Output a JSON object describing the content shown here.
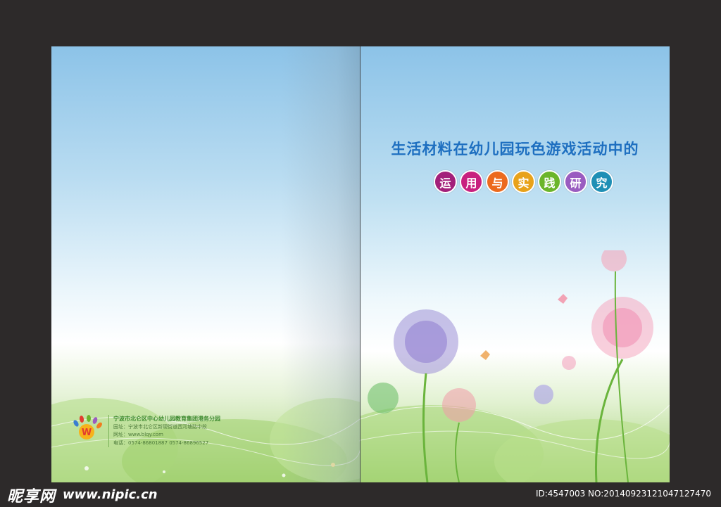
{
  "cover_title": "生活材料在幼儿园玩色游戏活动中的",
  "subtitle_chars": [
    {
      "char": "运",
      "color": "#a3207a"
    },
    {
      "char": "用",
      "color": "#c8207f"
    },
    {
      "char": "与",
      "color": "#ec6a1e"
    },
    {
      "char": "实",
      "color": "#e8a21a"
    },
    {
      "char": "践",
      "color": "#6bb52a"
    },
    {
      "char": "研",
      "color": "#9a5cc0"
    },
    {
      "char": "究",
      "color": "#1f8fb5"
    }
  ],
  "school": {
    "name": "宁波市北仑区中心幼儿园教育集团港务分园",
    "address": "园址：宁波市北仑区新碶街道西河塘路中段",
    "website": "网址：www.blqy.com",
    "phone": "电话：0574-86801887  0574-86896527"
  },
  "watermark": {
    "brand": "昵享网",
    "url": "www.nipic.cn",
    "photo_id": "ID:4547003 NO:20140923121047127470"
  }
}
